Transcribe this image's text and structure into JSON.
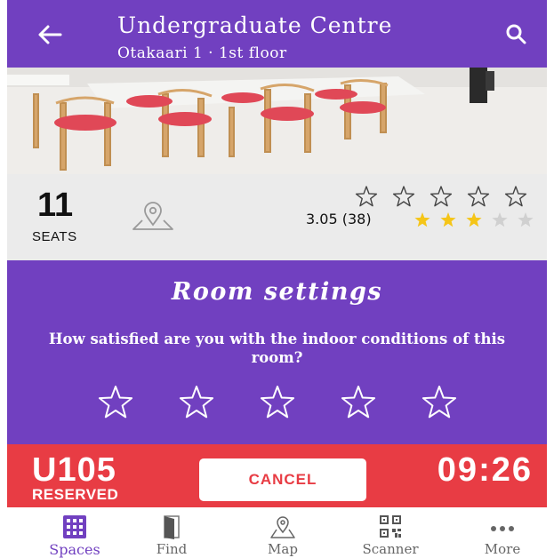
{
  "header": {
    "title": "Undergraduate Centre",
    "subtitle": "Otakaari 1 · 1st floor"
  },
  "info": {
    "seats": "11",
    "seats_label": "SEATS",
    "rating_text": "3.05 (38)",
    "average_rating": 3.05,
    "max_rating": 5
  },
  "settings": {
    "title": "Room settings",
    "question": "How satisfied are you with the indoor conditions of this room?"
  },
  "reservation": {
    "room_code": "U105",
    "status": "RESERVED",
    "cancel_label": "CANCEL",
    "time": "09:26"
  },
  "nav": {
    "items": [
      {
        "label": "Spaces",
        "icon": "grid-icon",
        "active": true
      },
      {
        "label": "Find",
        "icon": "door-icon",
        "active": false
      },
      {
        "label": "Map",
        "icon": "map-pin-icon",
        "active": false
      },
      {
        "label": "Scanner",
        "icon": "qr-code-icon",
        "active": false
      },
      {
        "label": "More",
        "icon": "more-dots-icon",
        "active": false
      }
    ]
  },
  "colors": {
    "purple": "#7140c0",
    "red": "#e83c44",
    "star_gold": "#f5c518",
    "star_grey": "#d0d0d0"
  }
}
